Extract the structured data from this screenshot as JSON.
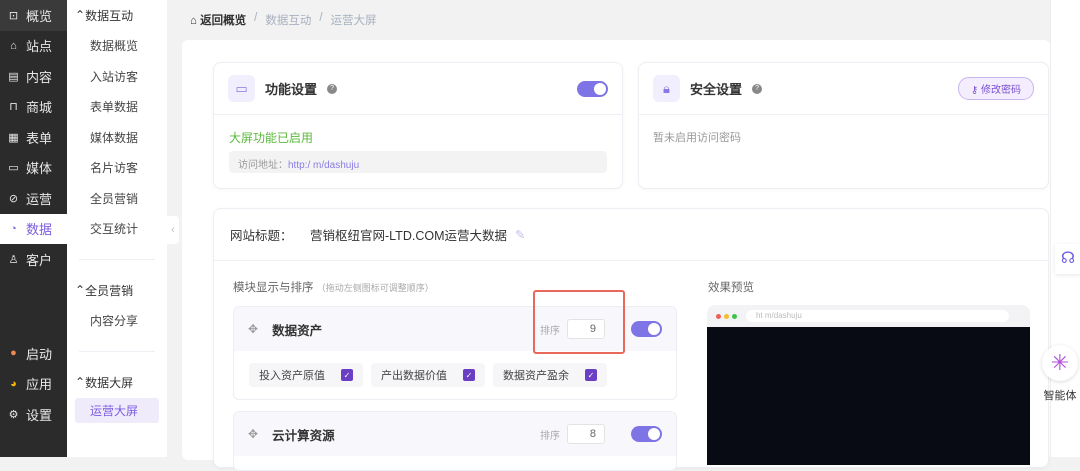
{
  "sidebar": {
    "items": [
      {
        "label": "概览",
        "icon": "chart-board-icon"
      },
      {
        "label": "站点",
        "icon": "home-icon"
      },
      {
        "label": "内容",
        "icon": "document-icon"
      },
      {
        "label": "商城",
        "icon": "cart-icon"
      },
      {
        "label": "表单",
        "icon": "form-icon"
      },
      {
        "label": "媒体",
        "icon": "video-icon"
      },
      {
        "label": "运营",
        "icon": "clip-icon"
      },
      {
        "label": "数据",
        "icon": "pie-icon"
      },
      {
        "label": "客户",
        "icon": "user-icon"
      }
    ],
    "bottom": [
      {
        "label": "启动"
      },
      {
        "label": "应用"
      },
      {
        "label": "设置"
      }
    ]
  },
  "subnav": {
    "groups": [
      {
        "title": "数据互动",
        "items": [
          "数据概览",
          "入站访客",
          "表单数据",
          "媒体数据",
          "名片访客",
          "全员营销",
          "交互统计"
        ]
      },
      {
        "title": "全员营销",
        "items": [
          "内容分享"
        ]
      },
      {
        "title": "数据大屏",
        "items": [
          "运营大屏"
        ]
      }
    ]
  },
  "breadcrumb": {
    "home": "返回概览",
    "items": [
      "数据互动",
      "运营大屏"
    ]
  },
  "feature": {
    "title": "功能设置",
    "status": "大屏功能已启用",
    "url_label": "访问地址：",
    "url": "http:/         m/dashuju",
    "enabled": true
  },
  "security": {
    "title": "安全设置",
    "button": "修改密码",
    "status": "暂未启用访问密码"
  },
  "site": {
    "label": "网站标题：",
    "value": "营销枢纽官网-LTD.COM运营大数据"
  },
  "modules": {
    "title": "模块显示与排序",
    "hint": "（拖动左侧图标可调整顺序）",
    "sort_label": "排序",
    "items": [
      {
        "name": "数据资产",
        "order": "9",
        "enabled": true,
        "options": [
          "投入资产原值",
          "产出数据价值",
          "数据资产盈余"
        ]
      },
      {
        "name": "云计算资源",
        "order": "8",
        "enabled": true
      }
    ]
  },
  "preview": {
    "title": "效果预览",
    "url": "ht          m/dashuju"
  },
  "right": {
    "agent": "智能体"
  },
  "colors": {
    "accent": "#7c5ce0",
    "sidebar": "#2b2b2b"
  }
}
